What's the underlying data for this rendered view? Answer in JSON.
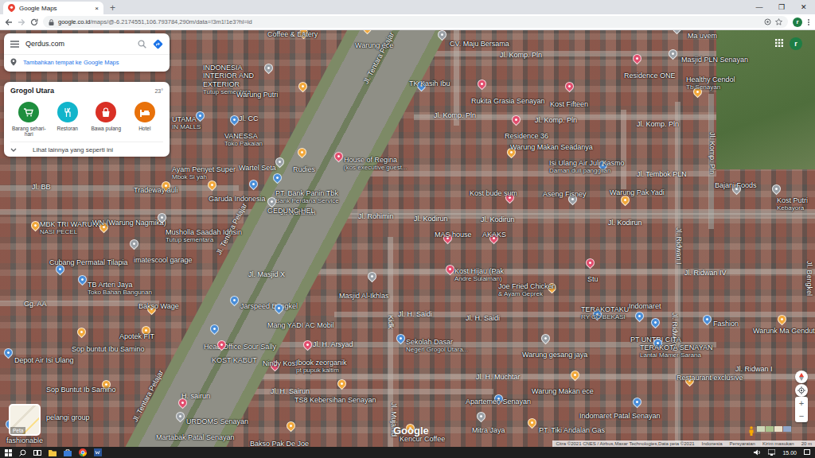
{
  "browser": {
    "tab": {
      "title": "Google Maps",
      "close": "×",
      "selected": true
    },
    "new_tab": "+",
    "window_controls": [
      "—",
      "❐",
      "✕"
    ],
    "url_host": "google.co.id",
    "url_path": "/maps/@-6.2174551,106.793784,290m/data=!3m1!1e3?hl=id",
    "profile": "r"
  },
  "search": {
    "value": "Qerdus.com",
    "add_place": "Tambahkan tempat ke Google Maps"
  },
  "area_card": {
    "title": "Grogol Utara",
    "temp": "23°",
    "categories": [
      {
        "label": "Barang sehari-hari",
        "color": "#1e8e3e"
      },
      {
        "label": "Restoran",
        "color": "#12b5cb"
      },
      {
        "label": "Bawa pulang",
        "color": "#d93025"
      },
      {
        "label": "Hotel",
        "color": "#e8710a"
      }
    ],
    "more": "Lihat lainnya yang seperti ini"
  },
  "account": "r",
  "layer_toggle": "Peta",
  "streets": [
    {
      "label": "Jl. Tentara Pelajar",
      "kind": "diag"
    },
    {
      "label": "Jl. Tentara Pelajar",
      "kind": "diag"
    },
    {
      "label": "Jl. Tentara Pelajar",
      "kind": "diag"
    },
    {
      "label": "Jl. Komp. Pln",
      "kind": "h"
    },
    {
      "label": "Jl. Komp. Pln",
      "kind": "h"
    },
    {
      "label": "Jl. Komp. Pln",
      "kind": "h"
    },
    {
      "label": "Jl. Komp. Pln",
      "kind": "h"
    },
    {
      "label": "Jl. Komp. Pln",
      "kind": "v"
    },
    {
      "label": "Jl. Tembok PLN",
      "kind": "h"
    },
    {
      "label": "Jl. CC",
      "kind": "h"
    },
    {
      "label": "Jl. BB",
      "kind": "h"
    },
    {
      "label": "Jl. Rohimin",
      "kind": "h"
    },
    {
      "label": "Jl. Rohimin",
      "kind": "h"
    },
    {
      "label": "Jl. Kodirun",
      "kind": "h"
    },
    {
      "label": "Jl. Kodirun",
      "kind": "h"
    },
    {
      "label": "Jl. Kodirun",
      "kind": "h"
    },
    {
      "label": "Jl. Ridwan I",
      "kind": "v"
    },
    {
      "label": "Jl. Ridwan IV",
      "kind": "h"
    },
    {
      "label": "Jl. Masjid X",
      "kind": "h"
    },
    {
      "label": "Gg. AA",
      "kind": "h"
    },
    {
      "label": "Jl. H. Saidi",
      "kind": "h"
    },
    {
      "label": "Jl. H. Saidi",
      "kind": "h"
    },
    {
      "label": "Kidk",
      "kind": "v"
    },
    {
      "label": "Jl. Ridwan II",
      "kind": "v"
    },
    {
      "label": "Jl. H. Arsyad",
      "kind": "h"
    },
    {
      "label": "Jl. H. Muchtar",
      "kind": "h"
    },
    {
      "label": "Jl. Ridwan I",
      "kind": "h"
    },
    {
      "label": "Jl. H. Sairun",
      "kind": "h"
    },
    {
      "label": "H. sairun",
      "kind": "h"
    },
    {
      "label": "Jl. Mujahid",
      "kind": "v"
    },
    {
      "label": "Jl. Bengkel",
      "kind": "v"
    }
  ],
  "places": [
    {
      "label": "Warung ece",
      "sub": "",
      "color": "#f2a83b"
    },
    {
      "label": "CV. Maju Bersama",
      "sub": "",
      "color": "#9aa0a6"
    },
    {
      "label": "Ma uvem",
      "sub": "",
      "color": "#9aa0a6"
    },
    {
      "label": "Masjid PLN Senayan",
      "sub": "",
      "color": "#9aa0a6"
    },
    {
      "label": "Healthy Cendol",
      "sub": "Tb Senayan",
      "color": "#f2a83b"
    },
    {
      "label": "Residence ONE",
      "sub": "",
      "color": "#e24e6e"
    },
    {
      "label": "TK Kasih Ibu",
      "sub": "",
      "color": "#4a8ed8"
    },
    {
      "label": "Rukita Grasia Senayan",
      "sub": "",
      "color": "#e24e6e"
    },
    {
      "label": "Kost Fifteen",
      "sub": "",
      "color": "#e24e6e"
    },
    {
      "label": "INDONESIA INTERIOR AND EXTERIOR",
      "sub": "Tutup sementara",
      "color": "#9aa0a6"
    },
    {
      "label": "Warung Putri",
      "sub": "",
      "color": "#f2a83b"
    },
    {
      "label": "Coffee & Eatery",
      "sub": "",
      "color": "#f2a83b"
    },
    {
      "label": "UTAMA",
      "sub": "IN MALLS",
      "color": "#4a8ed8"
    },
    {
      "label": "VANESSA",
      "sub": "Toko Pakaian",
      "color": "#4a8ed8"
    },
    {
      "label": "Residence 36",
      "sub": "",
      "color": "#e24e6e"
    },
    {
      "label": "Warung Makan Seadanya",
      "sub": "",
      "color": "#f2a83b"
    },
    {
      "label": "House of Regina",
      "sub": "(kos executive guest...",
      "color": "#e24e6e"
    },
    {
      "label": "Isi Ulang Air Juli Kasmo",
      "sub": "Daman dull panggilan",
      "color": "#4a8ed8"
    },
    {
      "label": "Wartel Seta",
      "sub": "",
      "color": "#9aa0a6"
    },
    {
      "label": "Rudies",
      "sub": "",
      "color": "#f2a83b"
    },
    {
      "label": "Ayam Penyet Super",
      "sub": "Mbok Si yah",
      "color": "#f2a83b"
    },
    {
      "label": "PT. Bank Panin Tbk",
      "sub": "Bank Perdana Service",
      "color": "#4a8ed8"
    },
    {
      "label": "Garuda Indonesia",
      "sub": "",
      "color": "#4a8ed8"
    },
    {
      "label": "Tradeway auli",
      "sub": "",
      "color": "#f2a83b"
    },
    {
      "label": "GEDUNG HEL",
      "sub": "",
      "color": "#9aa0a6"
    },
    {
      "label": "Kost bude sum",
      "sub": "",
      "color": "#e24e6e"
    },
    {
      "label": "Aseng Fisney",
      "sub": "",
      "color": "#9aa0a6"
    },
    {
      "label": "Warung Pak Yadi",
      "sub": "",
      "color": "#f2a83b"
    },
    {
      "label": "Bajani Foods",
      "sub": "",
      "color": "#9aa0a6"
    },
    {
      "label": "Kost Putri",
      "sub": "Kebayora",
      "color": "#9aa0a6"
    },
    {
      "label": "MBK TRI WARUNG",
      "sub": "NASI PECEL",
      "color": "#f2a83b"
    },
    {
      "label": "WN (Warung Nagmika)",
      "sub": "",
      "color": "#f2a83b"
    },
    {
      "label": "Musholla Saadah Idrisin",
      "sub": "Tutup sementara",
      "color": "#9aa0a6"
    },
    {
      "label": "imatescool garage",
      "sub": "",
      "color": "#9aa0a6"
    },
    {
      "label": "Cubang Permatal Tilapia",
      "sub": "",
      "color": "#4a8ed8"
    },
    {
      "label": "MAS house",
      "sub": "",
      "color": "#e24e6e"
    },
    {
      "label": "AKAKS",
      "sub": "",
      "color": "#e24e6e"
    },
    {
      "label": "Kost Hijau (Pak",
      "sub": "Andre Sulaiman)",
      "color": "#e24e6e"
    },
    {
      "label": "Joe Fried Chicken",
      "sub": "& Ayam Geprek",
      "color": "#f2a83b"
    },
    {
      "label": "Stu",
      "sub": "",
      "color": "#e24e6e"
    },
    {
      "label": "TB Arteri Jaya",
      "sub": "Toko Bahan Bangunan",
      "color": "#4a8ed8"
    },
    {
      "label": "Bakso Wage",
      "sub": "",
      "color": "#f2a83b"
    },
    {
      "label": "Jarspeed Bengkel",
      "sub": "",
      "color": "#4a8ed8"
    },
    {
      "label": "Masjid Al-Ikhlas",
      "sub": "",
      "color": "#9aa0a6"
    },
    {
      "label": "TERAKOTAKU",
      "sub": "RY CC BEKASI",
      "color": "#4a8ed8"
    },
    {
      "label": "Indomaret",
      "sub": "",
      "color": "#4a8ed8"
    },
    {
      "label": "PT UNTRI CITA",
      "sub": "",
      "color": "#4a8ed8"
    },
    {
      "label": "TERAKOTA SENAYAN",
      "sub": "Lantai Mamer Sarana",
      "color": "#4a8ed8"
    },
    {
      "label": "Fashion",
      "sub": "",
      "color": "#4a8ed8"
    },
    {
      "label": "Warunk Ma Gendut",
      "sub": "",
      "color": "#f2a83b"
    },
    {
      "label": "Apotek FIT",
      "sub": "",
      "color": "#f2a83b"
    },
    {
      "label": "Sop buntut Ibu Samino",
      "sub": "",
      "color": "#f2a83b"
    },
    {
      "label": "Mang YADI AC Mobil",
      "sub": "",
      "color": "#4a8ed8"
    },
    {
      "label": "Head Office Sour Sally",
      "sub": "",
      "color": "#4a8ed8"
    },
    {
      "label": "Sekolah Dasar",
      "sub": "Negeri Grogol Utara...",
      "color": "#4a8ed8"
    },
    {
      "label": "Warung gesang jaya",
      "sub": "",
      "color": "#9aa0a6"
    },
    {
      "label": "KOST KABUT",
      "sub": "",
      "color": "#e24e6e"
    },
    {
      "label": "Depot Air Isi Ulang",
      "sub": "",
      "color": "#4a8ed8"
    },
    {
      "label": "Nindy Kost",
      "sub": "",
      "color": "#e24e6e"
    },
    {
      "label": "Ibook zeorganik",
      "sub": "pt pupuk kaltim",
      "color": "#e24e6e"
    },
    {
      "label": "Restaurant exclusive",
      "sub": "",
      "color": "#f2a83b"
    },
    {
      "label": "Warung Makan ece",
      "sub": "",
      "color": "#f2a83b"
    },
    {
      "label": "TS8 Kebersihan Senayan",
      "sub": "",
      "color": "#f2a83b"
    },
    {
      "label": "Sop Buntut Ib Samino",
      "sub": "",
      "color": "#f2a83b"
    },
    {
      "label": "Apartemen Senayan",
      "sub": "",
      "color": "#4a8ed8"
    },
    {
      "label": "Indomaret Patal Senayan",
      "sub": "",
      "color": "#4a8ed8"
    },
    {
      "label": "URDOMS Senayan",
      "sub": "",
      "color": "#e24e6e"
    },
    {
      "label": "Mitra Jaya",
      "sub": "",
      "color": "#9aa0a6"
    },
    {
      "label": "PT. Tiki Andalan Gas",
      "sub": "",
      "color": "#f2a83b"
    },
    {
      "label": "Kencur Coffee",
      "sub": "",
      "color": "#f2a83b"
    },
    {
      "label": "Bakso Pak De Joe",
      "sub": "",
      "color": "#f2a83b"
    },
    {
      "label": "Martabak Patal Senayan",
      "sub": "",
      "color": "#9aa0a6"
    },
    {
      "label": "fashionable",
      "sub": "",
      "color": "#4a8ed8"
    },
    {
      "label": "pelangi group",
      "sub": "",
      "color": "#9aa0a6"
    }
  ],
  "logo": "Google",
  "zoom": {
    "in": "+",
    "out": "−"
  },
  "attribution": [
    "Citra ©2021 CNES / Airbus,Maxar Technologies,Data peta ©2021",
    "Indonesia",
    "Persyaratan",
    "Kirim masukan",
    "20 m"
  ],
  "taskbar": {
    "clock": "15.00"
  }
}
